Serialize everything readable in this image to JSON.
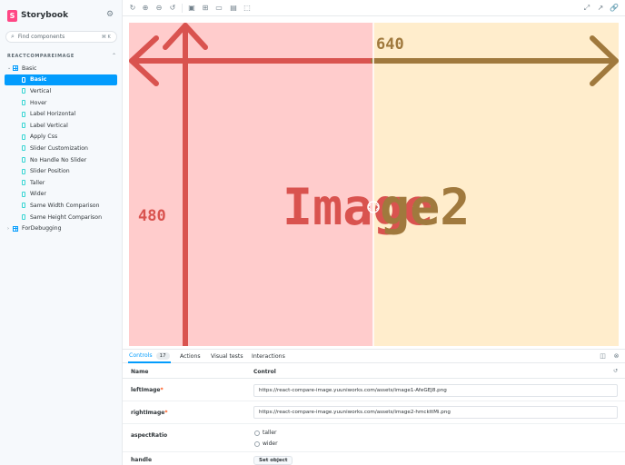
{
  "sidebar": {
    "brand": "Storybook",
    "search_placeholder": "Find components",
    "search_shortcut": "⌘ K",
    "section": "REACTCOMPAREIMAGE",
    "groups": [
      {
        "label": "Basic",
        "expanded": true
      },
      {
        "label": "ForDebugging",
        "expanded": false
      }
    ],
    "stories": [
      "Basic",
      "Vertical",
      "Hover",
      "Label Horizontal",
      "Label Vertical",
      "Apply Css",
      "Slider Customization",
      "No Handle No Slider",
      "Slider Position",
      "Taller",
      "Wider",
      "Same Width Comparison",
      "Same Height Comparison"
    ],
    "active_story": "Basic"
  },
  "preview": {
    "left_label": "Image",
    "right_label": "ge2",
    "width_label": "640",
    "height_label": "480",
    "left_color": "#ffcccc",
    "right_color": "#ffedcc",
    "left_ink": "#d9534f",
    "right_ink": "#a0793d"
  },
  "panel": {
    "tabs": [
      {
        "label": "Controls",
        "badge": "17"
      },
      {
        "label": "Actions"
      },
      {
        "label": "Visual tests"
      },
      {
        "label": "Interactions"
      }
    ],
    "col_name": "Name",
    "col_control": "Control",
    "rows": {
      "left_image": {
        "name": "leftImage",
        "value": "https://react-compare-image.yuuniworks.com/assets/image1-AfeGEJ8.png"
      },
      "right_image": {
        "name": "rightImage",
        "value": "https://react-compare-image.yuuniworks.com/assets/image2-hmckttMi.png"
      },
      "aspect_ratio": {
        "name": "aspectRatio",
        "options": [
          "taller",
          "wider"
        ]
      },
      "handle": {
        "name": "handle",
        "button": "Set object"
      }
    },
    "required_mark": "*"
  }
}
